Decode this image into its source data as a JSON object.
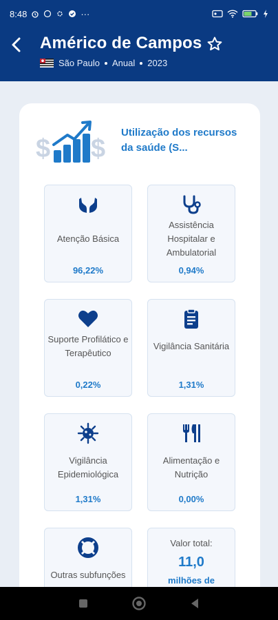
{
  "status_bar": {
    "time": "8:48",
    "dots": "···"
  },
  "header": {
    "title": "Américo de Campos",
    "state": "São Paulo",
    "period": "Anual",
    "year": "2023"
  },
  "card": {
    "title": "Utilização dos recursos da saúde (S..."
  },
  "tiles": [
    {
      "label": "Atenção Básica",
      "value": "96,22%",
      "icon": "hands-icon"
    },
    {
      "label": "Assistência Hospitalar e Ambulatorial",
      "value": "0,94%",
      "icon": "stethoscope-icon"
    },
    {
      "label": "Suporte Profilático e Terapêutico",
      "value": "0,22%",
      "icon": "heart-icon"
    },
    {
      "label": "Vigilância Sanitária",
      "value": "1,31%",
      "icon": "clipboard-icon"
    },
    {
      "label": "Vigilância Epidemiológica",
      "value": "1,31%",
      "icon": "virus-icon"
    },
    {
      "label": "Alimentação e Nutrição",
      "value": "0,00%",
      "icon": "utensils-icon"
    },
    {
      "label": "Outras subfunções",
      "value": "",
      "icon": "lifebuoy-icon"
    }
  ],
  "total": {
    "label": "Valor total:",
    "value": "11,0",
    "unit": "milhões de"
  },
  "colors": {
    "primary": "#0a3a82",
    "accent": "#1f7ac9",
    "tile_bg": "#f4f7fc"
  }
}
